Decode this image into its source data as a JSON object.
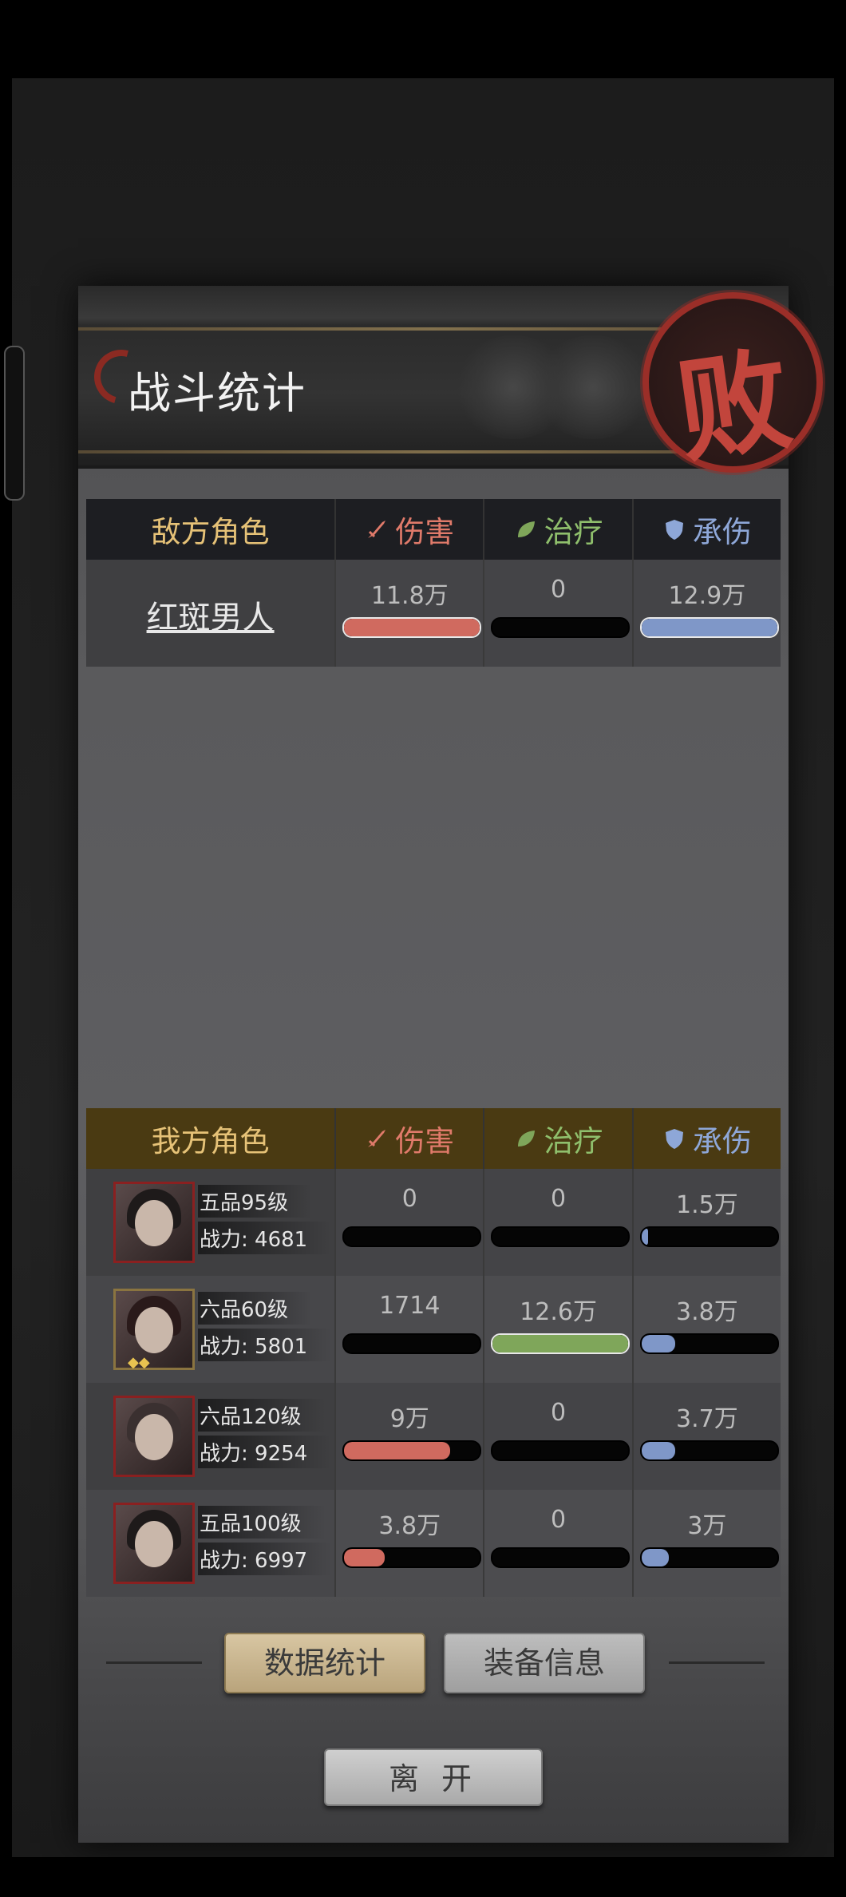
{
  "header": {
    "title": "战斗统计",
    "result_seal": "败"
  },
  "columns": {
    "damage": "伤害",
    "heal": "治疗",
    "taken": "承伤"
  },
  "enemy": {
    "label": "敌方角色",
    "rows": [
      {
        "name": "红斑男人",
        "damage": "11.8万",
        "heal": "0",
        "taken": "12.9万",
        "damage_ratio": 1.0,
        "heal_ratio": 0.0,
        "taken_ratio": 1.0
      }
    ]
  },
  "ally": {
    "label": "我方角色",
    "rows": [
      {
        "rank": "五品95级",
        "power_label": "战力:",
        "power": "4681",
        "damage": "0",
        "heal": "0",
        "taken": "1.5万",
        "damage_ratio": 0.0,
        "heal_ratio": 0.0,
        "taken_ratio": 0.05
      },
      {
        "rank": "六品60级",
        "power_label": "战力:",
        "power": "5801",
        "damage": "1714",
        "heal": "12.6万",
        "taken": "3.8万",
        "damage_ratio": 0.0,
        "heal_ratio": 1.0,
        "taken_ratio": 0.25
      },
      {
        "rank": "六品120级",
        "power_label": "战力:",
        "power": "9254",
        "damage": "9万",
        "heal": "0",
        "taken": "3.7万",
        "damage_ratio": 0.78,
        "heal_ratio": 0.0,
        "taken_ratio": 0.25
      },
      {
        "rank": "五品100级",
        "power_label": "战力:",
        "power": "6997",
        "damage": "3.8万",
        "heal": "0",
        "taken": "3万",
        "damage_ratio": 0.3,
        "heal_ratio": 0.0,
        "taken_ratio": 0.2
      }
    ]
  },
  "tabs": {
    "stats": "数据统计",
    "equipment": "装备信息"
  },
  "leave_button": "离开",
  "colors": {
    "damage": "#d06a5f",
    "heal": "#7fa65a",
    "taken": "#7f97c8",
    "seal": "#9a2e28"
  }
}
